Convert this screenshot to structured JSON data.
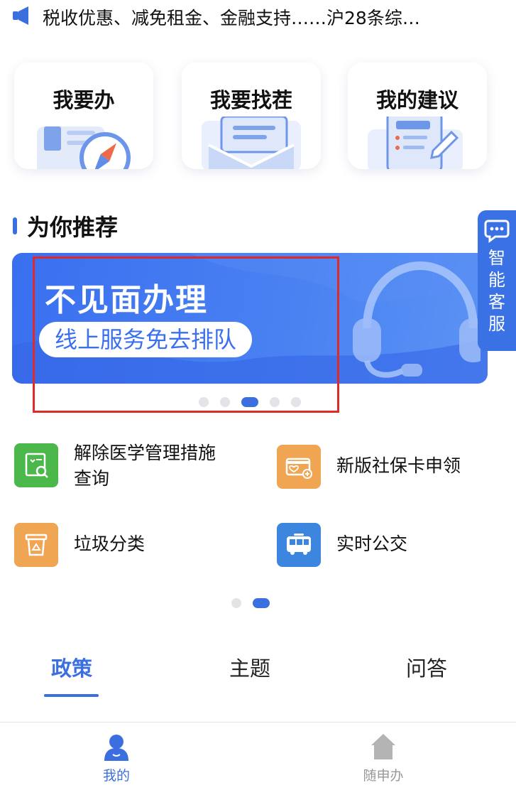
{
  "notice": {
    "icon": "speaker-icon",
    "text": "税收优惠、减免租金、金融支持……沪28条综…"
  },
  "quick_actions": [
    {
      "label": "我要办",
      "icon": "compass-document-icon"
    },
    {
      "label": "我要找茬",
      "icon": "envelope-icon"
    },
    {
      "label": "我的建议",
      "icon": "edit-document-icon"
    }
  ],
  "recommend": {
    "title": "为你推荐"
  },
  "customer_service": {
    "label": "智能客服",
    "icon": "chat-bubble-icon"
  },
  "banner": {
    "headline": "不见面办理",
    "subtitle": "线上服务免去排队",
    "icon": "headset-icon",
    "slide_count": 5,
    "active_slide": 3
  },
  "services": [
    {
      "label": "解除医学管理措施查询",
      "line1": "解除医学管理措施",
      "line2": "查询",
      "icon": "health-search-icon",
      "color": "#4cb84c"
    },
    {
      "label": "新版社保卡申领",
      "icon": "social-card-icon",
      "color": "#f0a552"
    },
    {
      "label": "垃圾分类",
      "icon": "recycle-bin-icon",
      "color": "#f0a552"
    },
    {
      "label": "实时公交",
      "icon": "bus-icon",
      "color": "#3d86e0"
    }
  ],
  "services_pager": {
    "pages": 2,
    "active_page": 2
  },
  "tabs": [
    {
      "label": "政策",
      "active": true
    },
    {
      "label": "主题",
      "active": false
    },
    {
      "label": "问答",
      "active": false
    }
  ],
  "bottom_nav": [
    {
      "label": "我的",
      "icon": "user-icon",
      "active": true
    },
    {
      "label": "随申办",
      "icon": "home-icon",
      "active": false
    }
  ],
  "colors": {
    "primary": "#3b6fe0",
    "banner": "#3a6ff0",
    "highlight": "#e02a2a",
    "inactive": "#b4b4b4"
  }
}
